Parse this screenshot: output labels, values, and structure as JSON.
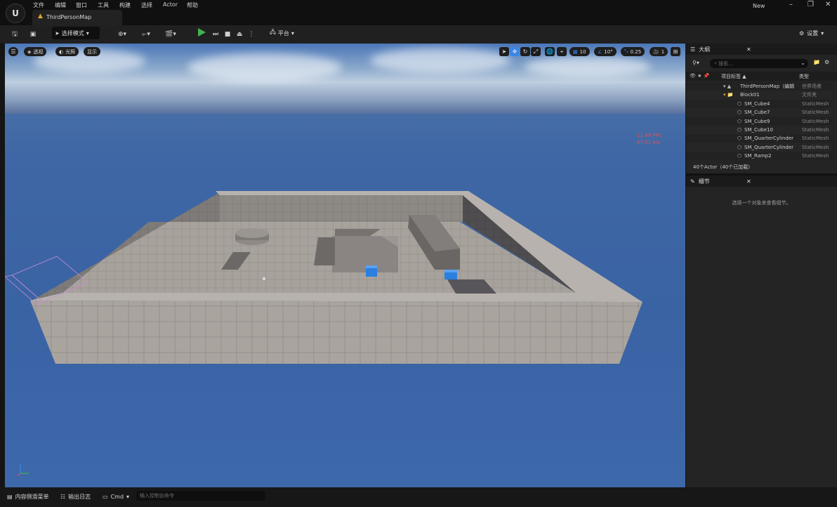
{
  "menu": [
    "文件",
    "编辑",
    "窗口",
    "工具",
    "构建",
    "选择",
    "Actor",
    "帮助"
  ],
  "tab": {
    "label": "ThirdPersonMap"
  },
  "window": {
    "new_label": "New"
  },
  "toolbar": {
    "mode_label": "选择模式",
    "platform_label": "平台",
    "settings_label": "设置"
  },
  "viewport": {
    "perspective_label": "透视",
    "lit_label": "光照",
    "show_label": "显示",
    "grid_snap": "10",
    "rot_snap": "10°",
    "scale_snap": "0.25",
    "camera_speed": "1",
    "fps": "11.49 FPS",
    "ms": "87.01 ms"
  },
  "outliner": {
    "title": "大纲",
    "search_placeholder": "搜索...",
    "col_label": "项目标签 ▲",
    "col_type": "类型",
    "rows": [
      {
        "label": "ThirdPersonMap（编辑",
        "type": "世界场景"
      },
      {
        "label": "Block01",
        "type": "文件夹"
      },
      {
        "label": "SM_Cube4",
        "type": "StaticMesh"
      },
      {
        "label": "SM_Cube7",
        "type": "StaticMesh"
      },
      {
        "label": "SM_Cube9",
        "type": "StaticMesh"
      },
      {
        "label": "SM_Cube10",
        "type": "StaticMesh"
      },
      {
        "label": "SM_QuarterCylinder",
        "type": "StaticMesh"
      },
      {
        "label": "SM_QuarterCylinder",
        "type": "StaticMesh"
      },
      {
        "label": "SM_Ramp2",
        "type": "StaticMesh"
      }
    ],
    "count": "40个Actor（40个已加载）"
  },
  "details": {
    "title": "细节",
    "hint": "选择一个对象来查看细节。"
  },
  "bottom": {
    "content_drawer": "内容侧滑菜单",
    "output_log": "输出日志",
    "cmd": "Cmd",
    "console_placeholder": "输入控制台命令"
  },
  "colors": {
    "accent": "#3a86e8",
    "play": "#3fb34f",
    "fps": "#e05050"
  }
}
